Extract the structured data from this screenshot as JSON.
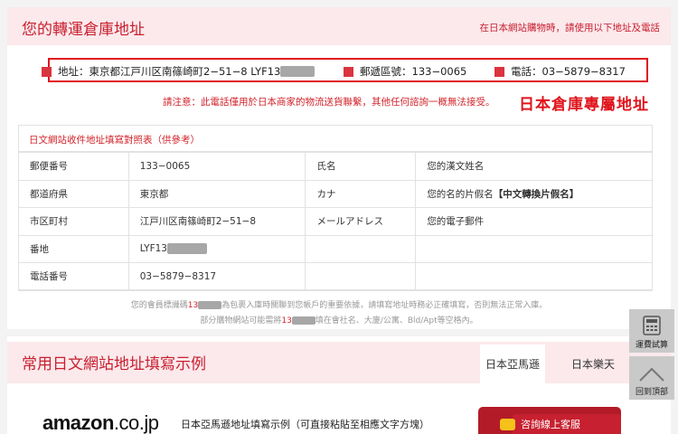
{
  "header": {
    "title": "您的轉運倉庫地址",
    "hint": "在日本網站購物時，請使用以下地址及電話"
  },
  "address_bar": {
    "address_label": "地址：",
    "address_value": "東京都江戸川区南篠崎町2−51−8 LYF13",
    "postal_label": "郵遞區號：",
    "postal_value": "133−0065",
    "phone_label": "電話：",
    "phone_value": "03−5879−8317"
  },
  "notice": "請注意：此電話僅用於日本商家的物流送貨聯繫，其他任何諮詢一概無法接受。",
  "exclusive_label": "日本倉庫專屬地址",
  "form_table": {
    "caption": "日文網站收件地址填寫對照表（供參考）",
    "rows": [
      {
        "k1": "郵便番号",
        "v1": "133−0065",
        "k2": "氏名",
        "v2": "您的漢文姓名"
      },
      {
        "k1": "都道府県",
        "v1": "東京都",
        "k2": "カナ",
        "v2": "您的名的片假名",
        "v2_extra": "【中文轉換片假名】"
      },
      {
        "k1": "市区町村",
        "v1": "江戸川区南篠崎町2−51−8",
        "k2": "メールアドレス",
        "v2": "您的電子郵件"
      },
      {
        "k1": "番地",
        "v1": "LYF13",
        "k2": "",
        "v2": ""
      },
      {
        "k1": "電話番号",
        "v1": "03−5879−8317",
        "k2": "",
        "v2": ""
      }
    ]
  },
  "footnotes": {
    "line1_a": "您的會員標識碼",
    "line1_num": "13",
    "line1_b": "為包裹入庫時關聯到您帳戶的重要依據，請填寫地址時務必正確填寫，否則無法正常入庫。",
    "line2_a": "部分購物網站可能需將",
    "line2_num": "13",
    "line2_b": "填在會社名、大廈/公寓、Bld/Apt等空格內。"
  },
  "section2": {
    "title": "常用日文網站地址填寫示例",
    "tabs": [
      "日本亞馬遜",
      "日本樂天"
    ],
    "active_tab": 0,
    "amazon_logo_main": "amazon",
    "amazon_logo_suffix": ".co.jp",
    "amazon_desc": "日本亞馬遜地址填寫示例（可直接粘貼至相應文字方塊）"
  },
  "floating": {
    "chat_label": "咨詢線上客服",
    "shipping_calc_label": "運費試算",
    "back_top_label": "回到頂部"
  },
  "colors": {
    "brand_red": "#c8202f",
    "highlight_red": "#e0141c",
    "header_pink": "#fbe9ec"
  }
}
